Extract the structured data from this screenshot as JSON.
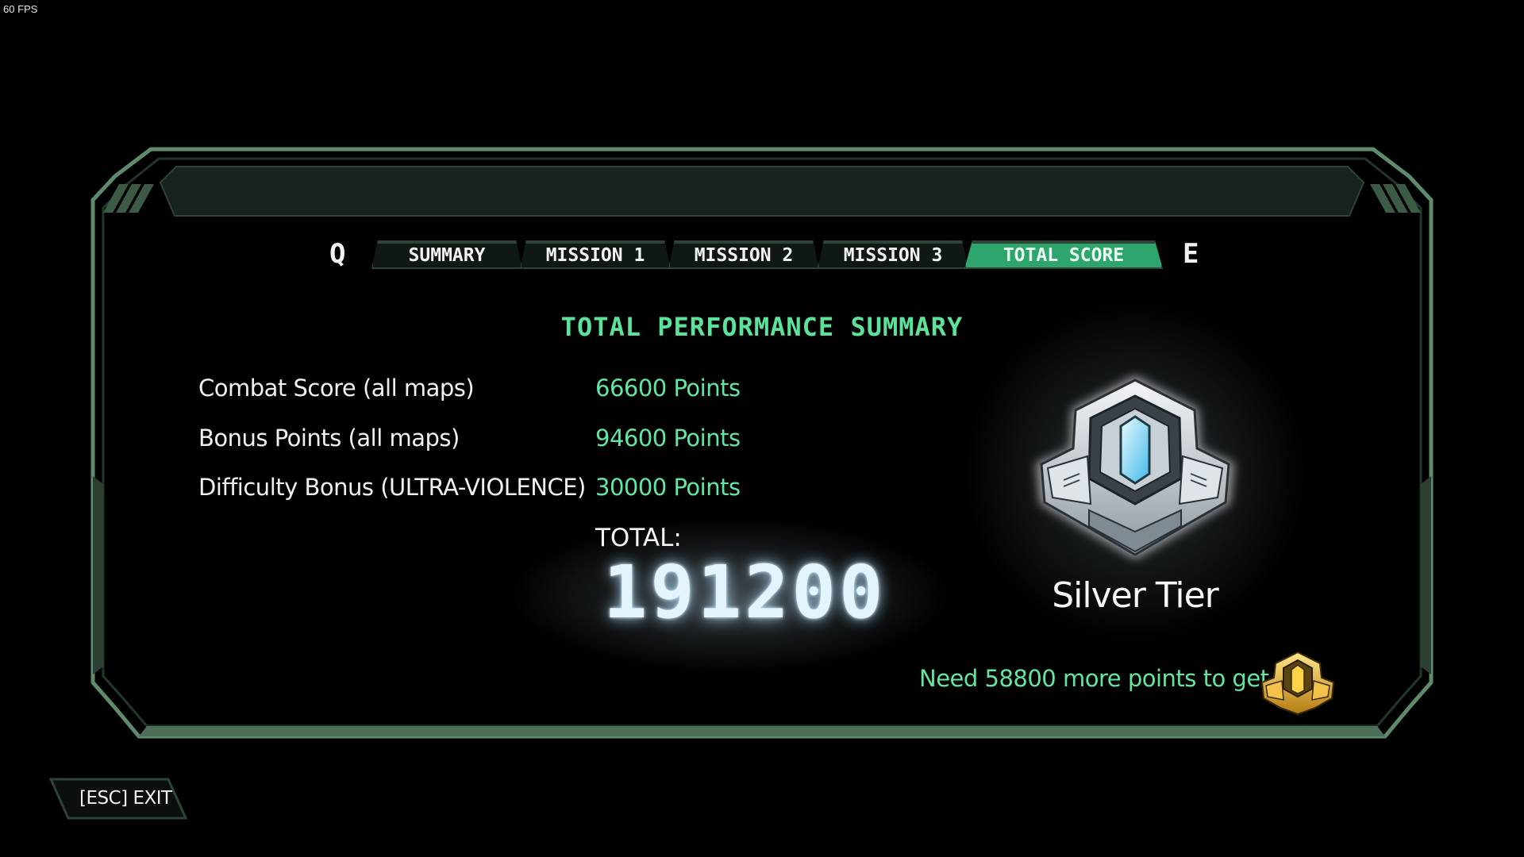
{
  "overlay": {
    "fps": "60 FPS"
  },
  "tabs": {
    "prev_key": "Q",
    "next_key": "E",
    "items": [
      {
        "label": "SUMMARY",
        "active": false
      },
      {
        "label": "MISSION 1",
        "active": false
      },
      {
        "label": "MISSION 2",
        "active": false
      },
      {
        "label": "MISSION 3",
        "active": false
      },
      {
        "label": "TOTAL SCORE",
        "active": true
      }
    ]
  },
  "summary": {
    "title": "TOTAL PERFORMANCE SUMMARY",
    "rows": [
      {
        "label": "Combat Score (all maps)",
        "value": "66600 Points"
      },
      {
        "label": "Bonus Points (all maps)",
        "value": "94600 Points"
      },
      {
        "label": "Difficulty Bonus (ULTRA-VIOLENCE)",
        "value": "30000 Points"
      }
    ],
    "total_label": "TOTAL:",
    "total_value": "191200"
  },
  "tier": {
    "name": "Silver Tier",
    "medal_icon": "silver-tier-medal-icon",
    "next_text": "Need 58800 more points to get",
    "next_medal_icon": "gold-tier-medal-icon"
  },
  "footer": {
    "exit_label": "[ESC]  EXIT"
  },
  "colors": {
    "accent_green": "#5be39a",
    "active_tab": "#2ea56d",
    "frame_green": "#5f8a6c",
    "background": "#000000"
  }
}
